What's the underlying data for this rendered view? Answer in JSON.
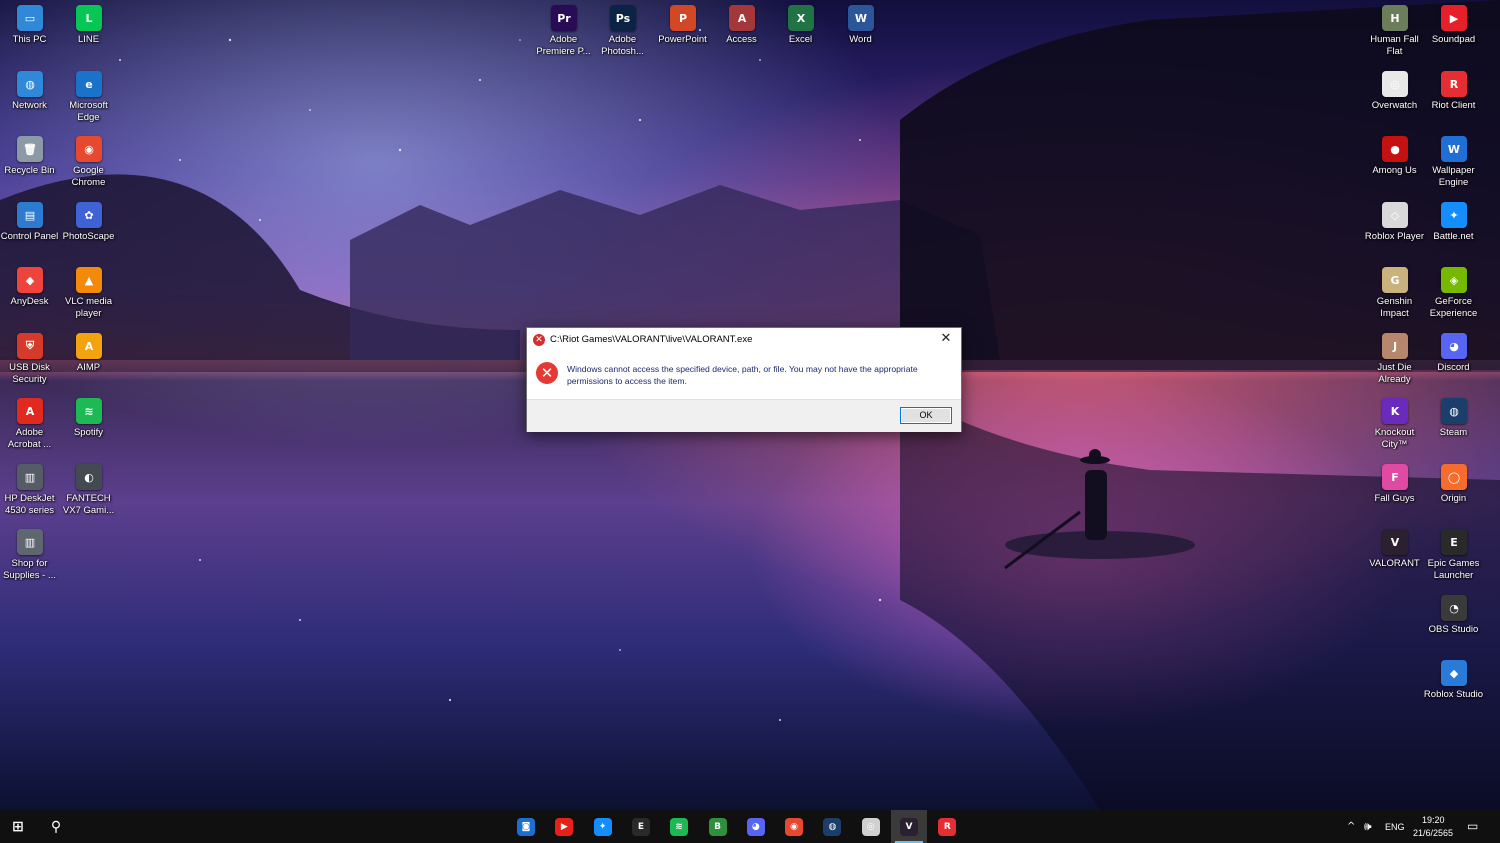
{
  "desktop_left_col1": [
    {
      "label": "This PC",
      "icon": "computer-icon",
      "color": "#2f88d8",
      "glyph": "▭"
    },
    {
      "label": "Network",
      "icon": "network-icon",
      "color": "#2f88d8",
      "glyph": "◍"
    },
    {
      "label": "Recycle Bin",
      "icon": "recycle-bin-icon",
      "color": "#8c99a6",
      "glyph": "🗑"
    },
    {
      "label": "Control Panel",
      "icon": "control-panel-icon",
      "color": "#2c7bd0",
      "glyph": "▤"
    },
    {
      "label": "AnyDesk",
      "icon": "anydesk-icon",
      "color": "#ef443b",
      "glyph": "◆"
    },
    {
      "label": "USB Disk Security",
      "icon": "usb-disk-security-icon",
      "color": "#d63a2a",
      "glyph": "⛨"
    },
    {
      "label": "Adobe Acrobat ...",
      "icon": "adobe-acrobat-icon",
      "color": "#e02a1f",
      "glyph": "A"
    },
    {
      "label": "HP DeskJet 4530 series",
      "icon": "printer-icon",
      "color": "#555c66",
      "glyph": "▥"
    },
    {
      "label": "Shop for Supplies - ...",
      "icon": "printer-shop-icon",
      "color": "#5e6670",
      "glyph": "▥"
    }
  ],
  "desktop_left_col2": [
    {
      "label": "LINE",
      "icon": "line-icon",
      "color": "#06c755",
      "glyph": "L"
    },
    {
      "label": "Microsoft Edge",
      "icon": "edge-icon",
      "color": "#1a73c9",
      "glyph": "e"
    },
    {
      "label": "Google Chrome",
      "icon": "chrome-icon",
      "color": "#e6492f",
      "glyph": "◉"
    },
    {
      "label": "PhotoScape",
      "icon": "photoscape-icon",
      "color": "#3f62d5",
      "glyph": "✿"
    },
    {
      "label": "VLC media player",
      "icon": "vlc-icon",
      "color": "#f48a0a",
      "glyph": "▲"
    },
    {
      "label": "AIMP",
      "icon": "aimp-icon",
      "color": "#f2a30f",
      "glyph": "A"
    },
    {
      "label": "Spotify",
      "icon": "spotify-icon",
      "color": "#1db954",
      "glyph": "≋"
    },
    {
      "label": "FANTECH VX7 Gami...",
      "icon": "fantech-mouse-icon",
      "color": "#444a52",
      "glyph": "◐"
    }
  ],
  "desktop_top_row": [
    {
      "label": "Adobe Premiere P...",
      "icon": "premiere-pro-icon",
      "color": "#2a0b55",
      "glyph": "Pr"
    },
    {
      "label": "Adobe Photosh...",
      "icon": "photoshop-icon",
      "color": "#0b2446",
      "glyph": "Ps"
    },
    {
      "label": "PowerPoint",
      "icon": "powerpoint-icon",
      "color": "#d24726",
      "glyph": "P"
    },
    {
      "label": "Access",
      "icon": "access-icon",
      "color": "#a4373a",
      "glyph": "A"
    },
    {
      "label": "Excel",
      "icon": "excel-icon",
      "color": "#217346",
      "glyph": "X"
    },
    {
      "label": "Word",
      "icon": "word-icon",
      "color": "#2b579a",
      "glyph": "W"
    }
  ],
  "desktop_right_col1": [
    {
      "label": "Human Fall Flat",
      "icon": "human-fall-flat-icon",
      "color": "#6b7d5a",
      "glyph": "H"
    },
    {
      "label": "Overwatch",
      "icon": "overwatch-icon",
      "color": "#e8e8e8",
      "glyph": "◎"
    },
    {
      "label": "Among Us",
      "icon": "among-us-icon",
      "color": "#c51111",
      "glyph": "●"
    },
    {
      "label": "Roblox Player",
      "icon": "roblox-icon",
      "color": "#d9d9d9",
      "glyph": "◇"
    },
    {
      "label": "Genshin Impact",
      "icon": "genshin-impact-icon",
      "color": "#c9b27e",
      "glyph": "G"
    },
    {
      "label": "Just Die Already",
      "icon": "just-die-already-icon",
      "color": "#b7876d",
      "glyph": "J"
    },
    {
      "label": "Knockout City™",
      "icon": "knockout-city-icon",
      "color": "#6a2bbd",
      "glyph": "K"
    },
    {
      "label": "Fall Guys",
      "icon": "fall-guys-icon",
      "color": "#e04aa2",
      "glyph": "F"
    },
    {
      "label": "VALORANT",
      "icon": "valorant-icon",
      "color": "#2a2030",
      "glyph": "V"
    }
  ],
  "desktop_right_col2": [
    {
      "label": "Soundpad",
      "icon": "soundpad-icon",
      "color": "#e5202a",
      "glyph": "▶"
    },
    {
      "label": "Riot Client",
      "icon": "riot-client-icon",
      "color": "#e52d34",
      "glyph": "R"
    },
    {
      "label": "Wallpaper Engine",
      "icon": "wallpaper-engine-icon",
      "color": "#1f6fd4",
      "glyph": "W"
    },
    {
      "label": "Battle.net",
      "icon": "battlenet-icon",
      "color": "#148eff",
      "glyph": "✦"
    },
    {
      "label": "GeForce Experience",
      "icon": "geforce-experience-icon",
      "color": "#76b900",
      "glyph": "◈"
    },
    {
      "label": "Discord",
      "icon": "discord-icon",
      "color": "#5865f2",
      "glyph": "◕"
    },
    {
      "label": "Steam",
      "icon": "steam-icon",
      "color": "#1b3f6a",
      "glyph": "◍"
    },
    {
      "label": "Origin",
      "icon": "origin-icon",
      "color": "#f56c2d",
      "glyph": "◯"
    },
    {
      "label": "Epic Games Launcher",
      "icon": "epic-games-icon",
      "color": "#2a2a2a",
      "glyph": "E"
    },
    {
      "label": "OBS Studio",
      "icon": "obs-studio-icon",
      "color": "#3a3a3a",
      "glyph": "◔"
    },
    {
      "label": "Roblox Studio",
      "icon": "roblox-studio-icon",
      "color": "#2a7ad9",
      "glyph": "◆"
    }
  ],
  "dialog": {
    "title": "C:\\Riot Games\\VALORANT\\live\\VALORANT.exe",
    "message": "Windows cannot access the specified device, path, or file. You may not have the appropriate permissions to access the item.",
    "ok_label": "OK",
    "close_glyph": "✕",
    "error_glyph": "✕"
  },
  "taskbar": {
    "start_glyph": "⊞",
    "search_glyph": "⚲",
    "apps": [
      {
        "icon": "camera-app-icon",
        "color": "#1c6fd1",
        "glyph": "◙"
      },
      {
        "icon": "youtube-icon",
        "color": "#e62117",
        "glyph": "▶"
      },
      {
        "icon": "battlenet-icon",
        "color": "#148eff",
        "glyph": "✦"
      },
      {
        "icon": "epic-games-icon",
        "color": "#2a2a2a",
        "glyph": "E"
      },
      {
        "icon": "spotify-icon",
        "color": "#1db954",
        "glyph": "≋"
      },
      {
        "icon": "b-app-icon",
        "color": "#2f8f3c",
        "glyph": "B"
      },
      {
        "icon": "discord-icon",
        "color": "#5865f2",
        "glyph": "◕"
      },
      {
        "icon": "chrome-icon",
        "color": "#e6492f",
        "glyph": "◉"
      },
      {
        "icon": "steam-icon",
        "color": "#1b3f6a",
        "glyph": "◍"
      },
      {
        "icon": "overwatch-icon",
        "color": "#d0d0d0",
        "glyph": "◎"
      },
      {
        "icon": "valorant-icon",
        "color": "#2a2030",
        "glyph": "V",
        "active": true
      },
      {
        "icon": "riot-client-icon",
        "color": "#e52d34",
        "glyph": "R"
      }
    ],
    "tray": {
      "chevron": "^",
      "volume": "🕪",
      "language": "ENG",
      "time": "19:20",
      "date": "21/6/2565",
      "notification_glyph": "▭"
    }
  }
}
